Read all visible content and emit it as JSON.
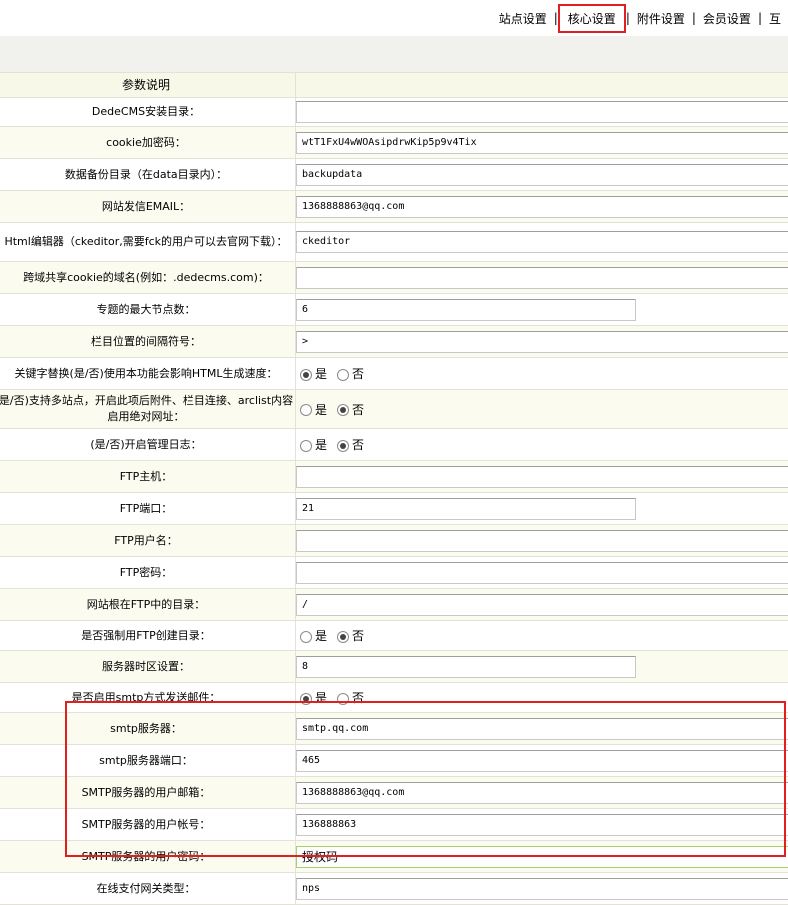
{
  "tabs": [
    {
      "label": "站点设置",
      "active": false
    },
    {
      "label": "核心设置",
      "active": true
    },
    {
      "label": "附件设置",
      "active": false
    },
    {
      "label": "会员设置",
      "active": false
    },
    {
      "label": "互",
      "active": false
    }
  ],
  "tab_separator": "|",
  "table_header": "参数说明",
  "rows": [
    {
      "label": "DedeCMS安装目录：",
      "type": "text",
      "value": "",
      "width": "wide"
    },
    {
      "label": "cookie加密码：",
      "type": "text",
      "value": "wtT1FxU4wWOAsipdrwKip5p9v4Tix",
      "width": "wide"
    },
    {
      "label": "数据备份目录（在data目录内）：",
      "type": "text",
      "value": "backupdata",
      "width": "wide"
    },
    {
      "label": "网站发信EMAIL：",
      "type": "text",
      "value": "1368888863@qq.com",
      "width": "wide"
    },
    {
      "label": "Html编辑器（ckeditor,需要fck的用户可以去官网下载）：",
      "type": "text",
      "value": "ckeditor",
      "width": "wide",
      "tall": true
    },
    {
      "label": "跨域共享cookie的域名(例如：.dedecms.com)：",
      "type": "text",
      "value": "",
      "width": "wide"
    },
    {
      "label": "专题的最大节点数：",
      "type": "text",
      "value": "6",
      "width": "narrow"
    },
    {
      "label": "栏目位置的间隔符号：",
      "type": "text",
      "value": " > ",
      "width": "wide"
    },
    {
      "label": "关键字替换(是/否)使用本功能会影响HTML生成速度：",
      "type": "radio",
      "selected": "yes"
    },
    {
      "label": "是/否)支持多站点，开启此项后附件、栏目连接、arclist内容启用绝对网址：",
      "type": "radio",
      "selected": "no",
      "tall": true
    },
    {
      "label": "(是/否)开启管理日志：",
      "type": "radio",
      "selected": "no"
    },
    {
      "label": "FTP主机：",
      "type": "text",
      "value": "",
      "width": "wide"
    },
    {
      "label": "FTP端口：",
      "type": "text",
      "value": "21",
      "width": "narrow"
    },
    {
      "label": "FTP用户名：",
      "type": "text",
      "value": "",
      "width": "wide"
    },
    {
      "label": "FTP密码：",
      "type": "text",
      "value": "",
      "width": "wide"
    },
    {
      "label": "网站根在FTP中的目录：",
      "type": "text",
      "value": "/",
      "width": "wide"
    },
    {
      "label": "是否强制用FTP创建目录：",
      "type": "radio",
      "selected": "no"
    },
    {
      "label": "服务器时区设置：",
      "type": "text",
      "value": "8",
      "width": "narrow"
    },
    {
      "label": "是否启用smtp方式发送邮件：",
      "type": "radio",
      "selected": "yes"
    },
    {
      "label": "smtp服务器：",
      "type": "text",
      "value": "smtp.qq.com",
      "width": "wide"
    },
    {
      "label": "smtp服务器端口：",
      "type": "text",
      "value": "465",
      "width": "wide"
    },
    {
      "label": "SMTP服务器的用户邮箱：",
      "type": "text",
      "value": "1368888863@qq.com",
      "width": "wide"
    },
    {
      "label": "SMTP服务器的用户帐号：",
      "type": "text",
      "value": "136888863",
      "width": "wide"
    },
    {
      "label": "SMTP服务器的用户密码：",
      "type": "text",
      "value": "授权码",
      "width": "wide",
      "focus": true
    },
    {
      "label": "在线支付网关类型：",
      "type": "text",
      "value": "nps",
      "width": "wide"
    }
  ],
  "radio_labels": {
    "yes": "是",
    "no": "否"
  },
  "colors": {
    "highlight": "#e02020",
    "row_alt": "#fbfbf0",
    "border": "#e2e3d6"
  }
}
